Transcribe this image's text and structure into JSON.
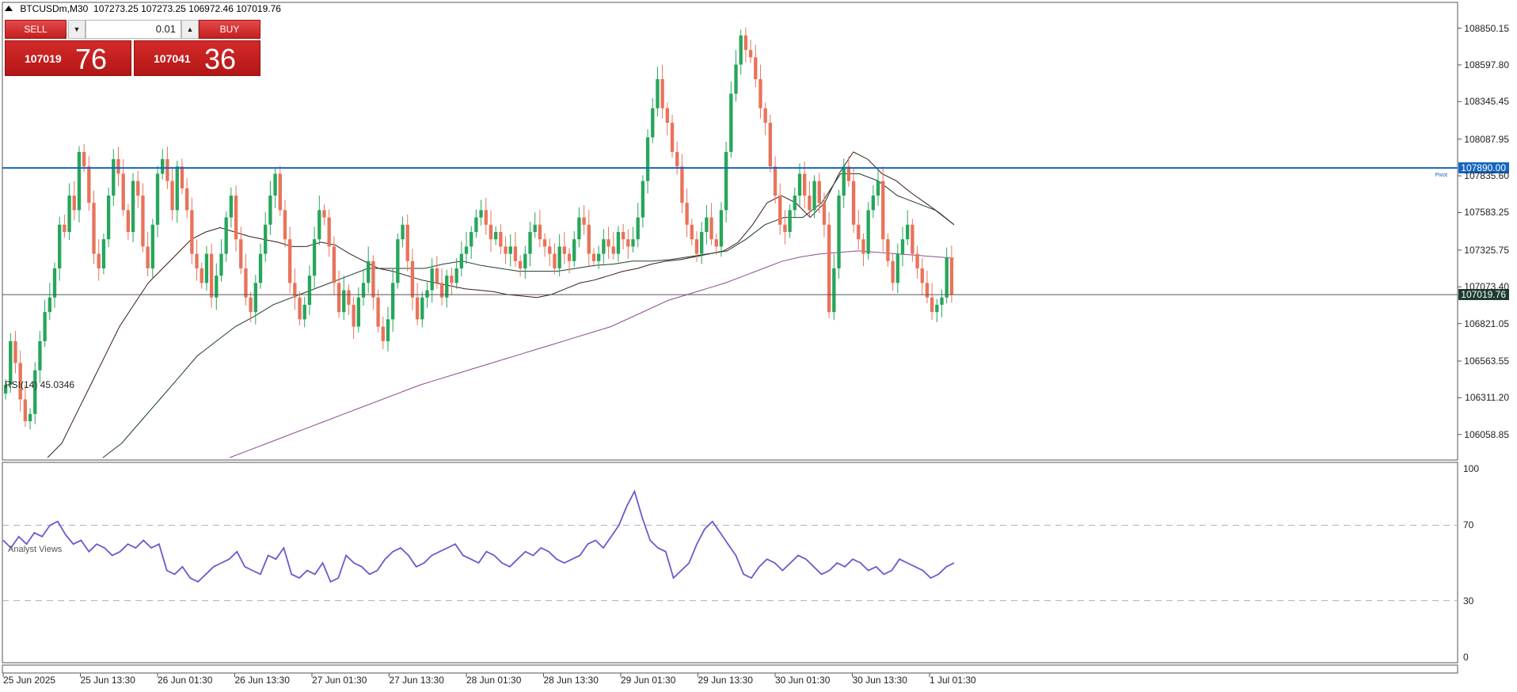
{
  "header": {
    "symbol": "BTCUSDm,M30",
    "ohlc": "107273.25 107273.25 106972.46 107019.76"
  },
  "trade_panel": {
    "sell_label": "SELL",
    "buy_label": "BUY",
    "lot_value": "0.01",
    "sell_price_small": "107019",
    "sell_price_big": "76",
    "buy_price_small": "107041",
    "buy_price_big": "36"
  },
  "colors": {
    "bull": "#26a65b",
    "bear": "#e8735a",
    "pivot_line": "#1565c0",
    "price_line": "#555555",
    "ma_fast": "#3a1a1a",
    "ma_mid": "#1f3c2c",
    "ma_slow": "#8e4a8e",
    "rsi_line": "#6a5acd"
  },
  "hline_pivot": {
    "value": "107890.00",
    "label": "Pivot"
  },
  "hline_price": {
    "value": "107019.76"
  },
  "rsi": {
    "title": "RSI(14) 45.0346",
    "levels": [
      100,
      70,
      30,
      0
    ]
  },
  "analyst_label": "Analyst Views",
  "chart_data": {
    "type": "candlestick",
    "ylim": [
      105900,
      109000
    ],
    "yticks": [
      "108850.15",
      "108597.80",
      "108345.45",
      "108087.95",
      "107835.60",
      "107583.25",
      "107325.75",
      "107073.40",
      "106821.05",
      "106563.55",
      "106311.20",
      "106058.85"
    ],
    "xticks": [
      "25 Jun 2025",
      "25 Jun 13:30",
      "26 Jun 01:30",
      "26 Jun 13:30",
      "27 Jun 01:30",
      "27 Jun 13:30",
      "28 Jun 01:30",
      "28 Jun 13:30",
      "29 Jun 01:30",
      "29 Jun 13:30",
      "30 Jun 01:30",
      "30 Jun 13:30",
      "1 Jul 01:30"
    ],
    "closes": [
      106400,
      106700,
      106550,
      106300,
      106150,
      106200,
      106500,
      106700,
      106900,
      107000,
      107200,
      107500,
      107450,
      107700,
      107600,
      108000,
      107900,
      107650,
      107300,
      107200,
      107400,
      107700,
      107950,
      107850,
      107600,
      107450,
      107800,
      107700,
      107350,
      107200,
      107500,
      107850,
      107950,
      107800,
      107600,
      107900,
      107750,
      107600,
      107300,
      107200,
      107100,
      107300,
      107000,
      107150,
      107300,
      107550,
      107700,
      107400,
      107200,
      107000,
      106900,
      107100,
      107300,
      107500,
      107700,
      107850,
      107600,
      107400,
      107100,
      107000,
      106850,
      106950,
      107150,
      107400,
      107600,
      107550,
      107350,
      107100,
      106900,
      107050,
      106950,
      106800,
      107000,
      107100,
      107250,
      107000,
      106800,
      106700,
      106850,
      107100,
      107400,
      107500,
      107250,
      107000,
      106850,
      107000,
      107050,
      107200,
      107100,
      107000,
      107150,
      107100,
      107200,
      107300,
      107350,
      107450,
      107550,
      107600,
      107500,
      107400,
      107450,
      107350,
      107300,
      107350,
      107250,
      107200,
      107300,
      107450,
      107500,
      107400,
      107350,
      107300,
      107200,
      107350,
      107300,
      107250,
      107400,
      107550,
      107500,
      107300,
      107250,
      107300,
      107400,
      107350,
      107300,
      107450,
      107400,
      107350,
      107400,
      107550,
      107800,
      108100,
      108300,
      108500,
      108300,
      108200,
      108000,
      107900,
      107650,
      107500,
      107400,
      107300,
      107450,
      107550,
      107400,
      107350,
      107600,
      108000,
      108400,
      108600,
      108800,
      108700,
      108650,
      108500,
      108300,
      108200,
      107900,
      107700,
      107500,
      107450,
      107600,
      107700,
      107850,
      107700,
      107600,
      107800,
      107650,
      107500,
      106900,
      107200,
      107700,
      107900,
      107800,
      107500,
      107400,
      107300,
      107600,
      107700,
      107800,
      107400,
      107250,
      107100,
      107300,
      107400,
      107500,
      107300,
      107200,
      107100,
      107000,
      106900,
      106950,
      107000,
      107273,
      107019
    ],
    "ma_fast": [
      105900,
      106000,
      106200,
      106400,
      106600,
      106800,
      106950,
      107100,
      107200,
      107300,
      107400,
      107450,
      107480,
      107450,
      107420,
      107400,
      107380,
      107350,
      107350,
      107380,
      107360,
      107300,
      107250,
      107200,
      107180,
      107150,
      107120,
      107100,
      107080,
      107060,
      107050,
      107040,
      107020,
      107010,
      107000,
      107020,
      107060,
      107100,
      107120,
      107150,
      107180,
      107200,
      107230,
      107250,
      107260,
      107280,
      107300,
      107320,
      107380,
      107500,
      107650,
      107700,
      107650,
      107550,
      107650,
      107850,
      108000,
      107950,
      107850,
      107800,
      107720,
      107650,
      107580,
      107500
    ],
    "ma_mid": [
      105900,
      106000,
      106150,
      106300,
      106450,
      106600,
      106700,
      106800,
      106870,
      106950,
      107000,
      107050,
      107100,
      107150,
      107200,
      107200,
      107200,
      107200,
      107230,
      107250,
      107220,
      107200,
      107180,
      107180,
      107180,
      107200,
      107220,
      107230,
      107250,
      107250,
      107260,
      107280,
      107300,
      107320,
      107400,
      107500,
      107550,
      107550,
      107650,
      107850,
      107850,
      107800,
      107700,
      107650,
      107600,
      107500
    ],
    "ma_slow": [
      105900,
      105950,
      106000,
      106050,
      106100,
      106150,
      106200,
      106250,
      106300,
      106350,
      106400,
      106440,
      106480,
      106520,
      106560,
      106600,
      106640,
      106680,
      106720,
      106760,
      106800,
      106860,
      106920,
      106980,
      107020,
      107060,
      107100,
      107150,
      107200,
      107250,
      107280,
      107300,
      107310,
      107320,
      107310,
      107300,
      107290,
      107280,
      107270
    ],
    "rsi_values": [
      62,
      58,
      64,
      60,
      66,
      64,
      70,
      72,
      65,
      60,
      62,
      56,
      60,
      58,
      54,
      56,
      60,
      58,
      62,
      58,
      60,
      46,
      44,
      48,
      42,
      40,
      44,
      48,
      50,
      52,
      56,
      48,
      46,
      44,
      54,
      52,
      58,
      44,
      42,
      46,
      44,
      50,
      40,
      42,
      54,
      50,
      48,
      44,
      46,
      52,
      56,
      58,
      54,
      48,
      50,
      54,
      56,
      58,
      60,
      54,
      52,
      50,
      56,
      54,
      50,
      48,
      52,
      56,
      54,
      58,
      56,
      52,
      50,
      52,
      54,
      60,
      62,
      58,
      64,
      70,
      80,
      88,
      74,
      62,
      58,
      56,
      42,
      46,
      50,
      60,
      68,
      72,
      66,
      60,
      54,
      44,
      42,
      48,
      52,
      50,
      46,
      50,
      54,
      52,
      48,
      44,
      46,
      50,
      48,
      52,
      50,
      46,
      48,
      44,
      46,
      52,
      50,
      48,
      46,
      42,
      44,
      48,
      50
    ],
    "rsi_ylim": [
      0,
      100
    ]
  }
}
